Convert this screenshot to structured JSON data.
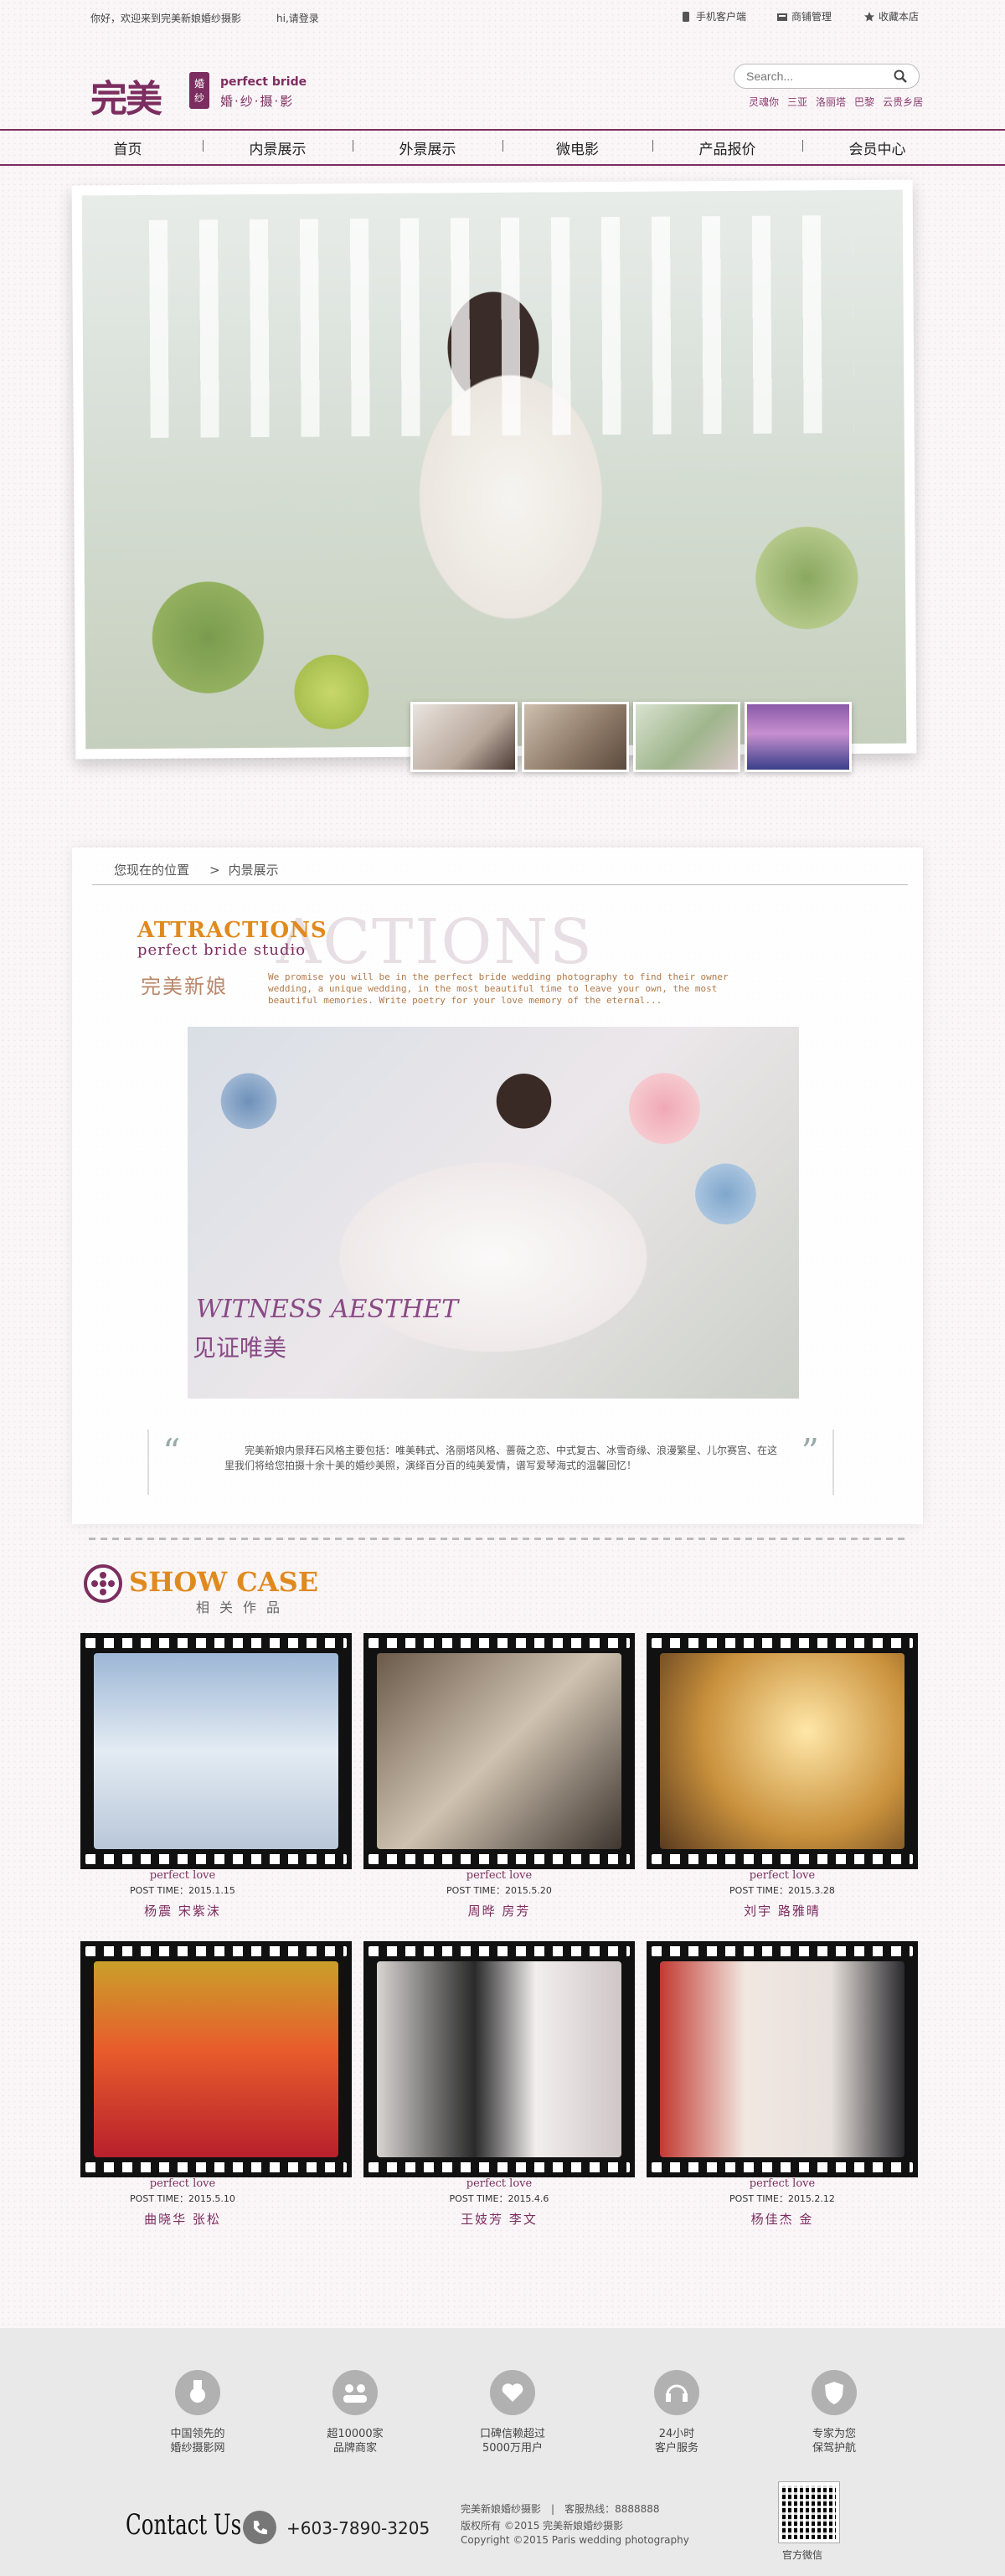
{
  "topbar": {
    "greeting": "你好，欢迎来到完美新娘婚纱摄影",
    "login": "hi,请登录",
    "links": [
      "手机客户端",
      "商铺管理",
      "收藏本店"
    ]
  },
  "logo": {
    "cn": "完美",
    "badge_top": "婚",
    "badge_bottom": "纱",
    "en": "perfect bride",
    "sub": "婚·纱·摄·影"
  },
  "search": {
    "placeholder": "Search..."
  },
  "hot_links": [
    "灵魂你",
    "三亚",
    "洛丽塔",
    "巴黎",
    "云贵乡居"
  ],
  "nav": [
    "首页",
    "内景展示",
    "外景展示",
    "微电影",
    "产品报价",
    "会员中心"
  ],
  "breadcrumb": {
    "label": "您现在的位置",
    "sep": ">",
    "current": "内景展示"
  },
  "section": {
    "watermark": "ACTIONS",
    "title": "ATTRACTIONS",
    "subtitle": "perfect bride studio",
    "brand_cn": "完美新娘",
    "intro": "We promise you will be in the perfect bride wedding photography to find their owner wedding, a unique wedding, in the most beautiful time to leave your own, the most beautiful memories. Write poetry for your love memory of the eternal...",
    "photo_text_en": "WITNESS AESTHET",
    "photo_text_cn": "见证唯美",
    "quote": "完美新娘内景拜石风格主要包括：唯美韩式、洛丽塔风格、蔷薇之恋、中式复古、冰雪奇缘、浪漫繁星、儿尔赛宫、在这里我们将给您拍摄十余十美的婚纱美照，演绎百分百的纯美爱情，谱写爱琴海式的温馨回忆！"
  },
  "showcase": {
    "title": "SHOW CASE",
    "subtitle": "相关作品",
    "items": [
      {
        "label": "perfect love",
        "time": "POST  TIME：2015.1.15",
        "names": "杨震  宋紫沫"
      },
      {
        "label": "perfect love",
        "time": "POST  TIME：2015.5.20",
        "names": "周晔  房芳"
      },
      {
        "label": "perfect love",
        "time": "POST  TIME：2015.3.28",
        "names": "刘宇  路雅晴"
      },
      {
        "label": "perfect love",
        "time": "POST  TIME：2015.5.10",
        "names": "曲晓华  张松"
      },
      {
        "label": "perfect love",
        "time": "POST  TIME：2015.4.6",
        "names": "王妓芳  李文"
      },
      {
        "label": "perfect love",
        "time": "POST  TIME：2015.2.12",
        "names": "杨佳杰  金"
      }
    ]
  },
  "footer": {
    "features": [
      {
        "line1": "中国领先的",
        "line2": "婚纱摄影网"
      },
      {
        "line1": "超10000家",
        "line2": "品牌商家"
      },
      {
        "line1": "口碑信赖超过",
        "line2": "5000万用户"
      },
      {
        "line1": "24小时",
        "line2": "客户服务"
      },
      {
        "line1": "专家为您",
        "line2": "保驾护航"
      }
    ],
    "contact_label": "Contact Us",
    "phone": "+603-7890-3205",
    "site_name": "完美新娘婚纱摄影",
    "hotline": "客服热线：8888888",
    "copyright1": "版权所有 ©2015 完美新娘婚纱摄影",
    "copyright2": "Copyright ©2015 Paris wedding photography",
    "qr_label": "官方微信"
  },
  "colors": {
    "brand": "#7b2e5f",
    "accent": "#e08a1e"
  }
}
